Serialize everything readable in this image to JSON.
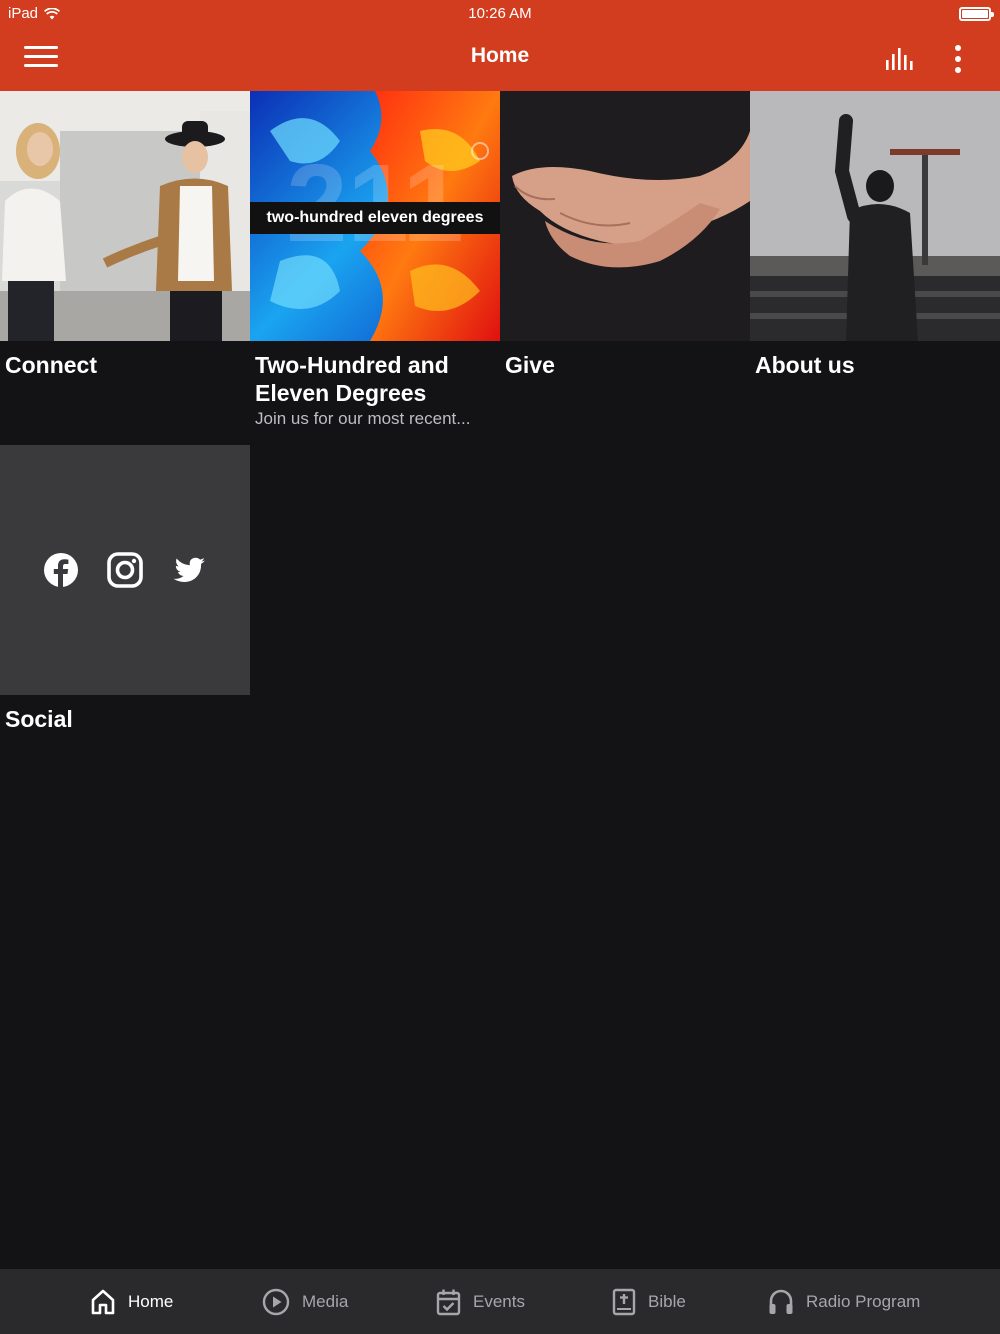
{
  "status_bar": {
    "device": "iPad",
    "time": "10:26 AM"
  },
  "header": {
    "title": "Home"
  },
  "tiles": [
    {
      "title": "Connect",
      "subtitle": ""
    },
    {
      "title": "Two-Hundred and Eleven Degrees",
      "subtitle": "Join us for our most recent...",
      "banner": "two-hundred eleven degrees"
    },
    {
      "title": "Give",
      "subtitle": ""
    },
    {
      "title": "About us",
      "subtitle": ""
    },
    {
      "title": "Social",
      "subtitle": ""
    }
  ],
  "social_links": [
    "facebook-icon",
    "instagram-icon",
    "twitter-icon"
  ],
  "tabbar": [
    {
      "label": "Home",
      "icon": "home-icon",
      "active": true
    },
    {
      "label": "Media",
      "icon": "play-circle-icon",
      "active": false
    },
    {
      "label": "Events",
      "icon": "calendar-check-icon",
      "active": false
    },
    {
      "label": "Bible",
      "icon": "bible-icon",
      "active": false
    },
    {
      "label": "Radio Program",
      "icon": "headphones-icon",
      "active": false
    }
  ],
  "colors": {
    "header": "#d33d1f",
    "background": "#131316",
    "tabbar": "#2a2a2c",
    "social_tile": "#3a3a3c"
  }
}
